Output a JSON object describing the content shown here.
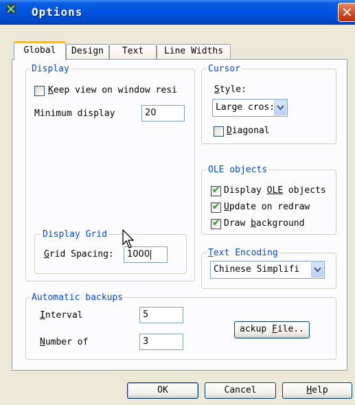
{
  "window": {
    "title": "Options"
  },
  "tabs": [
    {
      "label": "Global",
      "active": true
    },
    {
      "label": "Design",
      "active": false
    },
    {
      "label": "Text",
      "active": false
    },
    {
      "label": "Line Widths",
      "active": false
    }
  ],
  "display": {
    "legend": "Display",
    "keep_view_label": "Keep view on window resi",
    "keep_view_checked": false,
    "min_display_label": "Minimum display",
    "min_display_value": "20"
  },
  "cursor": {
    "legend": "Cursor",
    "style_label": "Style:",
    "style_value": "Large cros:",
    "diagonal_label": "Diagonal",
    "diagonal_checked": false
  },
  "ole": {
    "legend": "OLE objects",
    "display_label": "Display OLE objects",
    "update_label": "Update on redraw",
    "draw_bg_label": "Draw background",
    "display_checked": true,
    "update_checked": true,
    "draw_bg_checked": true
  },
  "grid": {
    "legend": "Display Grid",
    "spacing_label": "Grid Spacing:",
    "spacing_value": "1000"
  },
  "encoding": {
    "legend": "Text Encoding",
    "value": "Chinese Simplifi"
  },
  "backups": {
    "legend": "Automatic backups",
    "interval_label": "Interval",
    "interval_value": "5",
    "number_label": "Number of",
    "number_value": "3",
    "file_button": "ackup File.."
  },
  "buttons": {
    "ok": "OK",
    "cancel": "Cancel",
    "help": "Help"
  }
}
